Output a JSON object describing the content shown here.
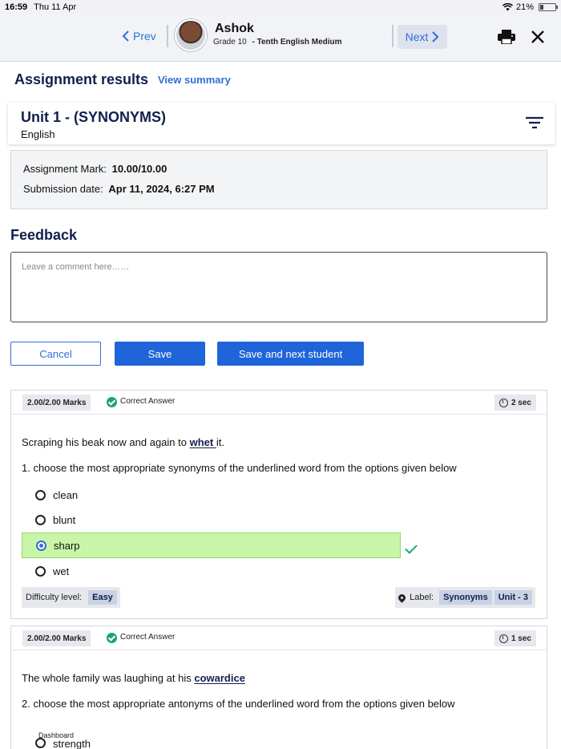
{
  "status_bar": {
    "time": "16:59",
    "date": "Thu 11 Apr",
    "battery": "21%",
    "battery_level": 0.21
  },
  "nav": {
    "prev_label": "Prev",
    "next_label": "Next",
    "student_name": "Ashok",
    "grade": "Grade 10",
    "section": "- Tenth English Medium"
  },
  "page": {
    "heading": "Assignment results",
    "view_summary": "View summary"
  },
  "unit": {
    "title": "Unit 1 - (SYNONYMS)",
    "subject": "English"
  },
  "marks": {
    "assignment_mark_label": "Assignment Mark:",
    "assignment_mark_value": "10.00/10.00",
    "submission_date_label": "Submission date:",
    "submission_date_value": "Apr 11, 2024, 6:27 PM"
  },
  "feedback": {
    "heading": "Feedback",
    "placeholder": "Leave a comment here……",
    "value": ""
  },
  "actions": {
    "cancel": "Cancel",
    "save": "Save",
    "save_next": "Save and next student"
  },
  "questions": [
    {
      "marks": "2.00/2.00 Marks",
      "status": "Correct Answer",
      "time": "2 sec",
      "sentence_before": "Scraping his beak now and again to ",
      "sentence_word": "whet ",
      "sentence_after": " it.",
      "prompt": "1. choose the most appropriate synonyms of the underlined word from the options given below",
      "options": [
        "clean",
        "blunt",
        "sharp",
        "wet"
      ],
      "selected_index": 2,
      "difficulty_label": "Difficulty level:",
      "difficulty_value": "Easy",
      "label_title": "Label:",
      "labels": [
        "Synonyms",
        "Unit - 3"
      ]
    },
    {
      "marks": "2.00/2.00 Marks",
      "status": "Correct Answer",
      "time": "1 sec",
      "sentence_before": "The whole family was laughing at his ",
      "sentence_word": "cowardice",
      "sentence_after": "",
      "prompt": "2. choose the most appropriate antonyms of the underlined word from the options given below",
      "options": [
        "strength"
      ]
    }
  ],
  "bottom_tab": {
    "dashboard": "Dashboard"
  }
}
